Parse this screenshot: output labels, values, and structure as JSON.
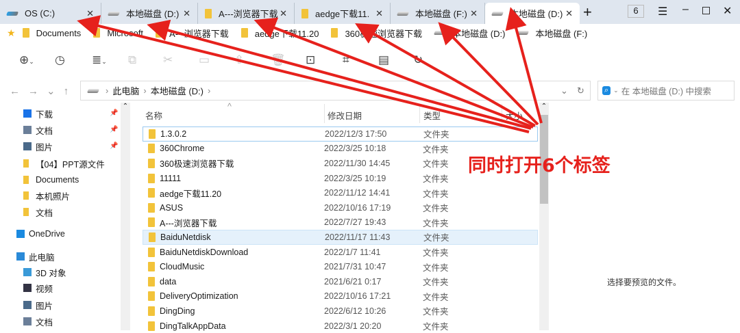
{
  "tabs": [
    {
      "label": "OS (C:)",
      "icon": "windows-drive"
    },
    {
      "label": "本地磁盘 (D:)",
      "icon": "drive"
    },
    {
      "label": "A---浏览器下载",
      "icon": "folder"
    },
    {
      "label": "aedge下载11.",
      "icon": "folder"
    },
    {
      "label": "本地磁盘 (F:)",
      "icon": "drive"
    },
    {
      "label": "本地磁盘 (D:)",
      "icon": "drive",
      "active": true
    }
  ],
  "tab_count": "6",
  "bookmarks": [
    {
      "label": "Documents",
      "icon": "folder"
    },
    {
      "label": "Microsoft",
      "icon": "folder"
    },
    {
      "label": "A---浏览器下载",
      "icon": "folder"
    },
    {
      "label": "aedge下载11.20",
      "icon": "folder"
    },
    {
      "label": "360极速浏览器下载",
      "icon": "folder"
    },
    {
      "label": "本地磁盘 (D:)",
      "icon": "drive"
    },
    {
      "label": "本地磁盘 (F:)",
      "icon": "drive"
    }
  ],
  "breadcrumb": [
    "此电脑",
    "本地磁盘 (D:)"
  ],
  "search_placeholder": "在 本地磁盘 (D:) 中搜索",
  "sidebar": [
    {
      "label": "下载",
      "pinned": true
    },
    {
      "label": "文档",
      "pinned": true
    },
    {
      "label": "图片",
      "pinned": true
    },
    {
      "label": "【04】PPT源文件"
    },
    {
      "label": "Documents"
    },
    {
      "label": "本机照片"
    },
    {
      "label": "文档"
    },
    {
      "label": "OneDrive"
    },
    {
      "label": "此电脑"
    },
    {
      "label": "3D 对象"
    },
    {
      "label": "视频"
    },
    {
      "label": "图片"
    },
    {
      "label": "文档"
    }
  ],
  "columns": {
    "name": "名称",
    "date": "修改日期",
    "type": "类型",
    "size": "大小"
  },
  "files": [
    {
      "name": "1.3.0.2",
      "date": "2022/12/3 17:50",
      "type": "文件夹"
    },
    {
      "name": "360Chrome",
      "date": "2022/3/25 10:18",
      "type": "文件夹"
    },
    {
      "name": "360极速浏览器下载",
      "date": "2022/11/30 14:45",
      "type": "文件夹"
    },
    {
      "name": "11111",
      "date": "2022/3/25 10:19",
      "type": "文件夹"
    },
    {
      "name": "aedge下载11.20",
      "date": "2022/11/12 14:41",
      "type": "文件夹"
    },
    {
      "name": "ASUS",
      "date": "2022/10/16 17:19",
      "type": "文件夹"
    },
    {
      "name": "A---浏览器下载",
      "date": "2022/7/27 19:43",
      "type": "文件夹"
    },
    {
      "name": "BaiduNetdisk",
      "date": "2022/11/17 11:43",
      "type": "文件夹"
    },
    {
      "name": "BaiduNetdiskDownload",
      "date": "2022/1/7 11:41",
      "type": "文件夹"
    },
    {
      "name": "CloudMusic",
      "date": "2021/7/31 10:47",
      "type": "文件夹"
    },
    {
      "name": "data",
      "date": "2021/6/21 0:17",
      "type": "文件夹"
    },
    {
      "name": "DeliveryOptimization",
      "date": "2022/10/16 17:21",
      "type": "文件夹"
    },
    {
      "name": "DingDing",
      "date": "2022/6/12 10:26",
      "type": "文件夹"
    },
    {
      "name": "DingTalkAppData",
      "date": "2022/3/1 20:20",
      "type": "文件夹"
    }
  ],
  "preview_text": "选择要预览的文件。",
  "annotation": "同时打开6个标签",
  "colors": {
    "annotation": "#e6211c",
    "tabbar": "#dfe6ef"
  }
}
